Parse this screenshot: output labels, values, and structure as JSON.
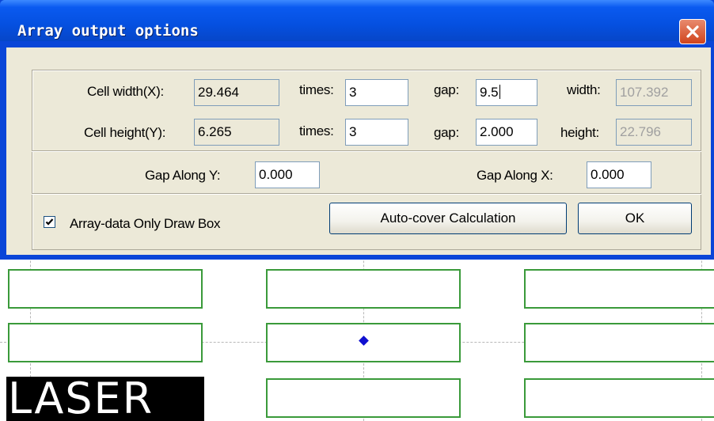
{
  "window": {
    "title": "Array output options",
    "close_icon": "close-icon"
  },
  "cell_width": {
    "label": "Cell width(X):",
    "value": "29.464"
  },
  "cell_height": {
    "label": "Cell height(Y):",
    "value": "6.265"
  },
  "x_row": {
    "times_label": "times:",
    "times_value": "3",
    "gap_label": "gap:",
    "gap_value": "9.5",
    "total_label": "width:",
    "total_value": "107.392"
  },
  "y_row": {
    "times_label": "times:",
    "times_value": "3",
    "gap_label": "gap:",
    "gap_value": "2.000",
    "total_label": "height:",
    "total_value": "22.796"
  },
  "gap_along_y": {
    "label": "Gap Along Y:",
    "value": "0.000"
  },
  "gap_along_x": {
    "label": "Gap Along X:",
    "value": "0.000"
  },
  "checkbox": {
    "label": "Array-data Only Draw Box",
    "checked": true
  },
  "buttons": {
    "auto_cover": "Auto-cover Calculation",
    "ok": "OK"
  },
  "canvas": {
    "logo_text": "LASER",
    "cell_color": "#3a9a3a",
    "origin_color": "#1010d0"
  },
  "colors": {
    "titlebar": "#0550e0",
    "dialog_bg": "#ece9d8",
    "close_button": "#d0441c"
  }
}
